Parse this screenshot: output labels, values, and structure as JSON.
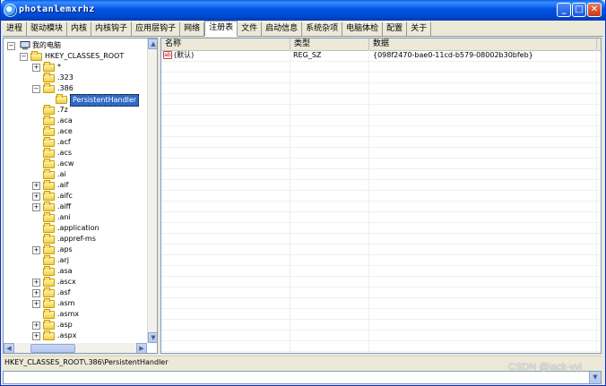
{
  "window": {
    "title": "photanlemxrhz"
  },
  "titlebar_buttons": {
    "minimize": "_",
    "maximize": "□",
    "close": "✕"
  },
  "tabs": [
    "进程",
    "驱动模块",
    "内核",
    "内核钩子",
    "应用层钩子",
    "网络",
    "注册表",
    "文件",
    "启动信息",
    "系统杂项",
    "电脑体检",
    "配置",
    "关于"
  ],
  "active_tab": "注册表",
  "tree": {
    "root": "我的电脑",
    "hive": "HKEY_CLASSES_ROOT",
    "items": [
      {
        "label": "*",
        "expander": "+"
      },
      {
        "label": ".323",
        "expander": ""
      },
      {
        "label": ".386",
        "expander": "−"
      },
      {
        "label": "PersistentHandler",
        "expander": "",
        "child": true,
        "selected": true
      },
      {
        "label": ".7z",
        "expander": ""
      },
      {
        "label": ".aca",
        "expander": ""
      },
      {
        "label": ".ace",
        "expander": ""
      },
      {
        "label": ".acf",
        "expander": ""
      },
      {
        "label": ".acs",
        "expander": ""
      },
      {
        "label": ".acw",
        "expander": ""
      },
      {
        "label": ".ai",
        "expander": ""
      },
      {
        "label": ".aif",
        "expander": "+"
      },
      {
        "label": ".aifc",
        "expander": "+"
      },
      {
        "label": ".aiff",
        "expander": "+"
      },
      {
        "label": ".ani",
        "expander": ""
      },
      {
        "label": ".application",
        "expander": ""
      },
      {
        "label": ".appref-ms",
        "expander": ""
      },
      {
        "label": ".aps",
        "expander": "+"
      },
      {
        "label": ".arj",
        "expander": ""
      },
      {
        "label": ".asa",
        "expander": ""
      },
      {
        "label": ".ascx",
        "expander": "+"
      },
      {
        "label": ".asf",
        "expander": "+"
      },
      {
        "label": ".asm",
        "expander": "+"
      },
      {
        "label": ".asmx",
        "expander": ""
      },
      {
        "label": ".asp",
        "expander": "+"
      },
      {
        "label": ".aspx",
        "expander": "+"
      }
    ]
  },
  "list": {
    "headers": [
      "名称",
      "类型",
      "数据"
    ],
    "rows": [
      {
        "icon": "ab",
        "name": "(默认)",
        "type": "REG_SZ",
        "data": "{098f2470-bae0-11cd-b579-08002b30bfeb}"
      }
    ]
  },
  "status": "HKEY_CLASSES_ROOT\\.386\\PersistentHandler",
  "watermark": "CSDN @jack-yyj",
  "scroll": {
    "up": "▲",
    "down": "▼",
    "left": "◀",
    "right": "▶"
  }
}
